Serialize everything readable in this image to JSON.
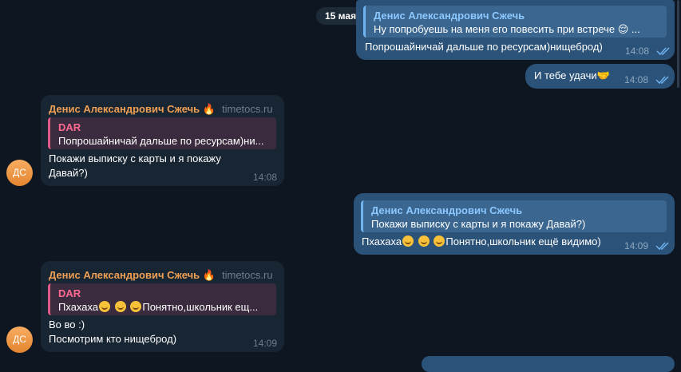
{
  "date_separator": "15 мая",
  "messages": {
    "m1": {
      "reply_name": "Денис Александрович Сжечь",
      "reply_text": "Ну попробуешь на меня его повесить при встрече 😌 ...",
      "text": "Попрошайничай дальше по ресурсам)нищеброд)",
      "time": "14:08"
    },
    "m2": {
      "text": "И тебе удачи🤝",
      "time": "14:08"
    },
    "m3": {
      "sender": "Денис Александрович Сжечь 🔥",
      "site": "timetocs.ru",
      "reply_name": "DAR",
      "reply_text": "Попрошайничай дальше по ресурсам)ни...",
      "line1": "Покажи выписку с карты и я покажу",
      "line2": "Давай?)",
      "time": "14:08",
      "avatar": "ДС"
    },
    "m4": {
      "reply_name": "Денис Александрович Сжечь",
      "reply_text": "Покажи выписку с карты и я покажу Давай?)",
      "text_a": "Пхахаха",
      "text_b": "Понятно,школьник ещё видимо)",
      "time": "14:09"
    },
    "m5": {
      "sender": "Денис Александрович Сжечь 🔥",
      "site": "timetocs.ru",
      "reply_name": "DAR",
      "reply_text_a": "Пхахаха",
      "reply_text_b": "Понятно,школьник ещ...",
      "line1": "Во во :)",
      "line2": "Посмотрим кто нищеброд)",
      "time": "14:09",
      "avatar": "ДС"
    }
  },
  "colors": {
    "background": "#0e1621",
    "outgoing_bubble": "#2b5278",
    "incoming_bubble": "#182533",
    "sender_name": "#ef9f53",
    "reply_accent_out": "#6fb3f0",
    "reply_accent_in": "#e0598b"
  },
  "icons": [
    "read-check-icon",
    "emoji-laugh-icon"
  ]
}
